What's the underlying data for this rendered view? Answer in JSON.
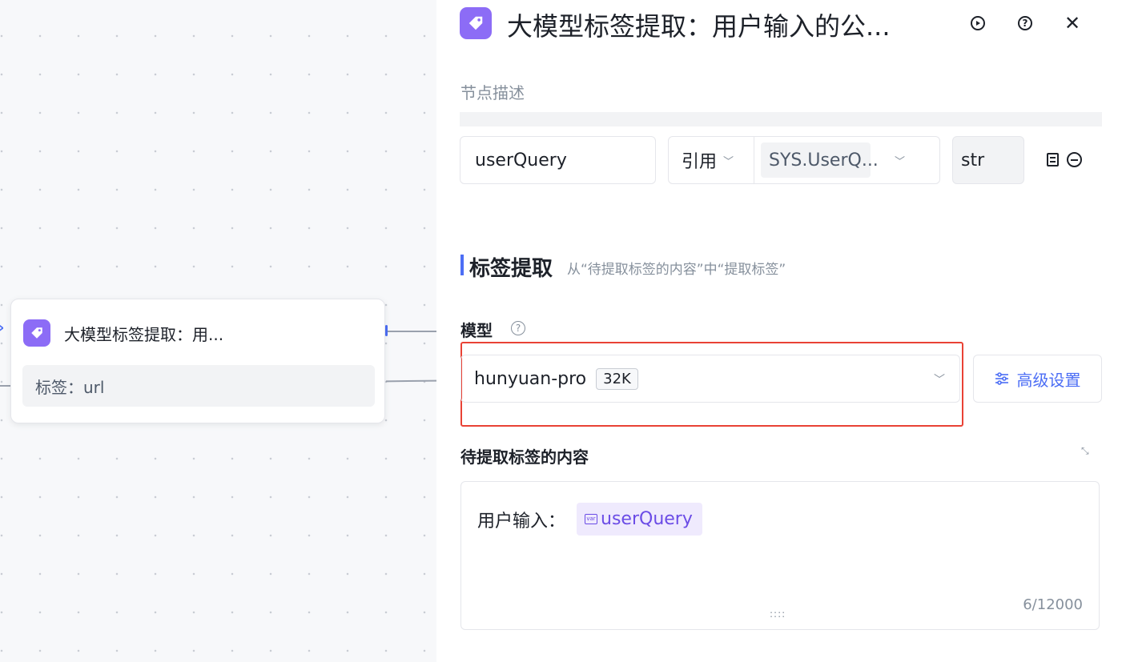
{
  "canvas": {
    "node": {
      "title": "大模型标签提取：用...",
      "tag": "标签：url",
      "icon": "tag-icon"
    }
  },
  "panel": {
    "title": "大模型标签提取：用户输入的公...",
    "icons": {
      "header": "tag-icon",
      "run": "play-circle-icon",
      "help": "question-circle-icon",
      "close": "close-icon"
    },
    "description_placeholder": "节点描述",
    "param": {
      "name": "userQuery",
      "ref_mode": "引用",
      "ref_value": "SYS.UserQ...",
      "type": "str"
    },
    "section": {
      "title": "标签提取",
      "hint": "从“待提取标签的内容”中“提取标签”"
    },
    "model": {
      "label": "模型",
      "name": "hunyuan-pro",
      "context": "32K",
      "advanced_label": "高级设置"
    },
    "content": {
      "label": "待提取标签的内容",
      "prefix": "用户输入：",
      "var_badge": "var",
      "variable": "userQuery",
      "count": "6/12000"
    },
    "colors": {
      "accent": "#4c6ef5",
      "icon_bg": "#8c6cf6",
      "highlight": "#e94235"
    }
  }
}
